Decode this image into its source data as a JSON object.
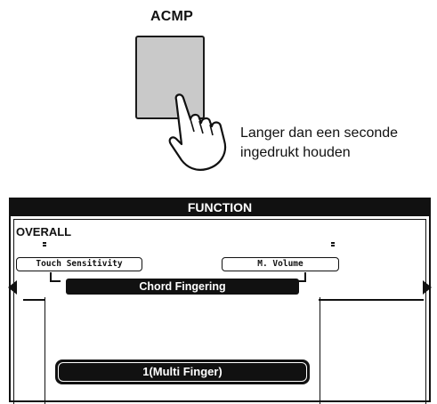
{
  "button": {
    "label": "ACMP",
    "color": "#c9c9c9"
  },
  "instruction": {
    "line1": "Langer dan een seconde",
    "line2": "ingedrukt houden"
  },
  "lcd": {
    "title": "FUNCTION",
    "category": "OVERALL",
    "left_item": "Touch Sensitivity",
    "right_item": "M. Volume",
    "selected_item": "Chord Fingering",
    "value": "1(Multi Finger)",
    "icons": {
      "left": "left-arrow-icon",
      "right": "right-arrow-icon",
      "hand": "pressing-hand-icon"
    }
  }
}
